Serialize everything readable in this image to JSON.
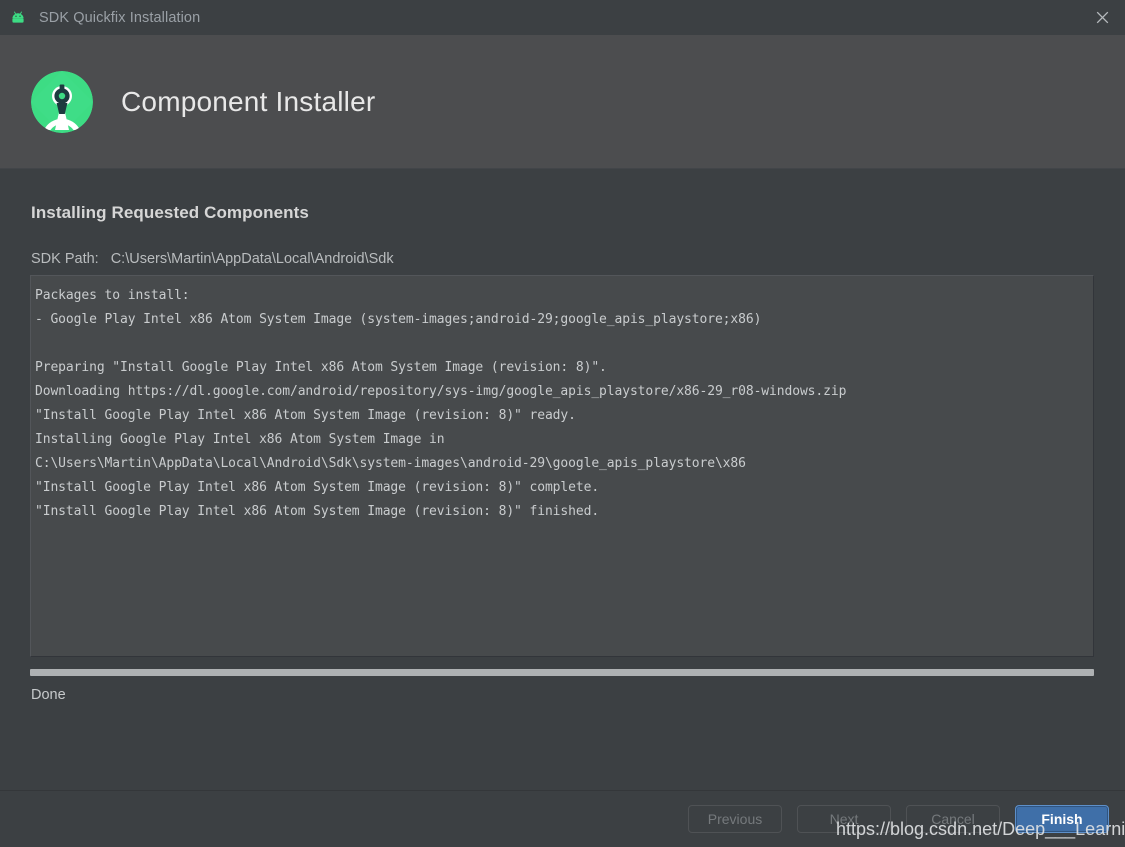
{
  "window": {
    "title": "SDK Quickfix Installation",
    "title_icon": "android-robot-icon",
    "close_icon": "close-icon"
  },
  "header": {
    "logo_icon": "android-studio-logo",
    "title": "Component Installer"
  },
  "main": {
    "step_title": "Installing Requested Components",
    "sdk_path_label": "SDK Path:",
    "sdk_path_value": "C:\\Users\\Martin\\AppData\\Local\\Android\\Sdk",
    "console_lines": [
      "Packages to install:",
      "- Google Play Intel x86 Atom System Image (system-images;android-29;google_apis_playstore;x86)",
      "",
      "Preparing \"Install Google Play Intel x86 Atom System Image (revision: 8)\".",
      "Downloading https://dl.google.com/android/repository/sys-img/google_apis_playstore/x86-29_r08-windows.zip",
      "\"Install Google Play Intel x86 Atom System Image (revision: 8)\" ready.",
      "Installing Google Play Intel x86 Atom System Image in",
      "C:\\Users\\Martin\\AppData\\Local\\Android\\Sdk\\system-images\\android-29\\google_apis_playstore\\x86",
      "\"Install Google Play Intel x86 Atom System Image (revision: 8)\" complete.",
      "\"Install Google Play Intel x86 Atom System Image (revision: 8)\" finished."
    ],
    "progress_percent": 100,
    "status_text": "Done"
  },
  "footer": {
    "previous_label": "Previous",
    "next_label": "Next",
    "cancel_label": "Cancel",
    "finish_label": "Finish"
  },
  "overlay": {
    "watermark": "https://blog.csdn.net/Deep___Learning"
  },
  "colors": {
    "window_bg": "#3c4043",
    "header_bg": "#4c4d4f",
    "console_bg": "#474a4c",
    "accent_blue": "#3f6fa8",
    "android_green": "#3ddc84",
    "progress_fill": "#aeb1b3",
    "text_primary": "#d6d6d6",
    "text_muted": "#9aa0a6"
  }
}
